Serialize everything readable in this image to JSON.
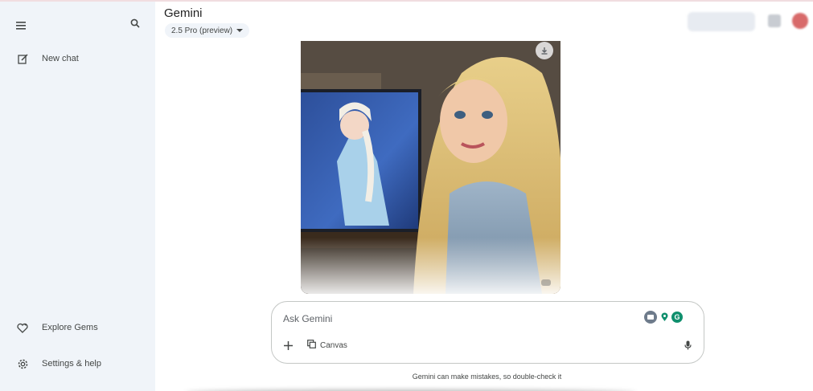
{
  "app": {
    "title": "Gemini",
    "model_label": "2.5 Pro (preview)"
  },
  "sidebar": {
    "items": [
      {
        "label": "New chat",
        "icon": "edit-icon"
      },
      {
        "label": "Explore Gems",
        "icon": "gem-icon"
      },
      {
        "label": "Settings & help",
        "icon": "gear-icon"
      }
    ]
  },
  "image": {
    "description_icon": "download-icon"
  },
  "composer": {
    "placeholder": "Ask Gemini",
    "canvas_label": "Canvas"
  },
  "footer": {
    "disclaimer": "Gemini can make mistakes, so double-check it"
  },
  "colors": {
    "sidebar_bg": "#f0f4f9",
    "accent_green": "#0f8f6d",
    "chip_bg": "#f0f4f9"
  }
}
